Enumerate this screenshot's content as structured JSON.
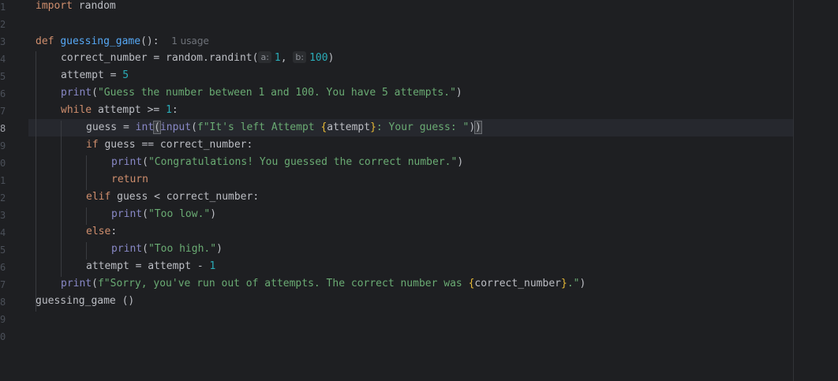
{
  "editor": {
    "line_numbers": [
      "1",
      "2",
      "3",
      "4",
      "5",
      "6",
      "7",
      "8",
      "9",
      "0",
      "1",
      "2",
      "3",
      "4",
      "5",
      "6",
      "7",
      "8",
      "9",
      "0"
    ],
    "active_line": "8",
    "usage_hint": "1 usage",
    "param_hints": {
      "a": "a:",
      "b": "b:"
    },
    "colors": {
      "background": "#1e1f22",
      "keyword": "#cf8e6d",
      "function": "#56a8f5",
      "string": "#6aab73",
      "number": "#2aacb8",
      "builtin": "#8888c6",
      "fstring_brace": "#e8ba36"
    },
    "tokens": {
      "l1_kw": "import",
      "l1_rest": " random",
      "l3_kw": "def",
      "l3_fn": "guessing_game",
      "l3_rest": "():",
      "l4_a": "correct_number = random.randint(",
      "l4_n1": "1",
      "l4_comma": ", ",
      "l4_n2": "100",
      "l4_close": ")",
      "l5_a": "attempt = ",
      "l5_n": "5",
      "l6_fn": "print",
      "l6_open": "(",
      "l6_str": "\"Guess the number between 1 and 100. You have 5 attempts.\"",
      "l6_close": ")",
      "l7_kw": "while",
      "l7_a": " attempt >= ",
      "l7_n": "1",
      "l7_colon": ":",
      "l8_a": "guess = ",
      "l8_int": "int",
      "l8_paren": "(",
      "l8_input": "input",
      "l8_open": "(",
      "l8_str1": "f\"It's left Attempt ",
      "l8_lb": "{",
      "l8_var": "attempt",
      "l8_rb": "}",
      "l8_str2": ": Your guess: \"",
      "l8_close1": ")",
      "l8_close2": ")",
      "l9_kw": "if",
      "l9_rest": " guess == correct_number:",
      "l10_fn": "print",
      "l10_open": "(",
      "l10_str": "\"Congratulations! You guessed the correct number.\"",
      "l10_close": ")",
      "l11_kw": "return",
      "l12_kw": "elif",
      "l12_rest": " guess < correct_number:",
      "l13_fn": "print",
      "l13_open": "(",
      "l13_str": "\"Too low.\"",
      "l13_close": ")",
      "l14_kw": "else",
      "l14_colon": ":",
      "l15_fn": "print",
      "l15_open": "(",
      "l15_str": "\"Too high.\"",
      "l15_close": ")",
      "l16_a": "attempt = attempt - ",
      "l16_n": "1",
      "l17_fn": "print",
      "l17_open": "(",
      "l17_str1": "f\"Sorry, you've run out of attempts. The correct number was ",
      "l17_lb": "{",
      "l17_var": "correct_number",
      "l17_rb": "}",
      "l17_str2": ".\"",
      "l17_close": ")",
      "l18_call": "guessing_game ()"
    }
  }
}
